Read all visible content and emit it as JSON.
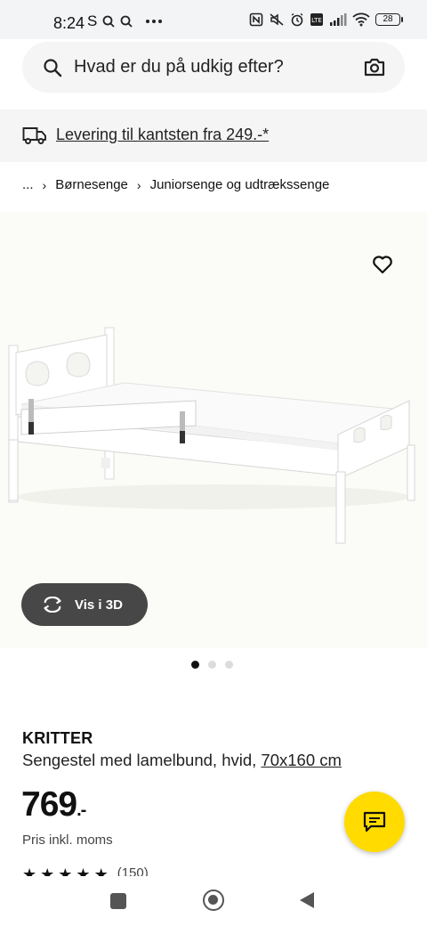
{
  "status_bar": {
    "time": "8:24",
    "left_glyphs": [
      "S"
    ],
    "battery": "28",
    "icons": [
      "s-app-icon",
      "search-notification-icon",
      "search-notification-icon",
      "more-dots-icon",
      "nfc-icon",
      "mute-icon",
      "alarm-icon",
      "volte-icon",
      "signal-icon",
      "wifi-icon",
      "battery-icon"
    ]
  },
  "search": {
    "placeholder": "Hvad er du på udkig efter?"
  },
  "delivery": {
    "text": "Levering til kantsten fra 249.-*"
  },
  "breadcrumb": {
    "items": [
      "...",
      "Børnesenge",
      "Juniorsenge og udtrækssenge"
    ]
  },
  "media": {
    "vis3d_label": "Vis i 3D",
    "dots_total": 3,
    "dots_active_index": 0
  },
  "product": {
    "name": "KRITTER",
    "description": "Sengestel med lamelbund, hvid, ",
    "size": "70x160 cm",
    "price": "769",
    "price_suffix": ".-",
    "vat_note": "Pris inkl. moms",
    "rating_count": "(150)"
  },
  "colors": {
    "accent_yellow": "#ffdb00",
    "button_dark": "#474747",
    "banner_bg": "#f5f5f5",
    "image_bg": "#fbfbf7"
  }
}
